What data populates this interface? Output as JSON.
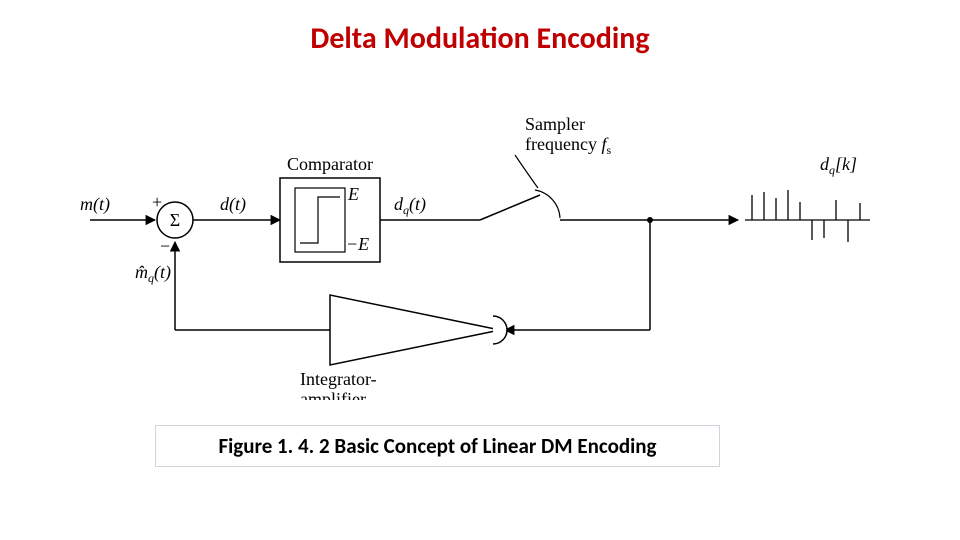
{
  "title": "Delta Modulation Encoding",
  "caption": "Figure 1. 4. 2  Basic Concept of Linear DM Encoding",
  "labels": {
    "input": "m(t)",
    "sum": "Σ",
    "plus": "+",
    "minus": "−",
    "feedback": "m̂",
    "feedback_sub": "q",
    "feedback_arg": "(t)",
    "diff": "d(t)",
    "comparator_title": "Comparator",
    "comp_high": "E",
    "comp_low": "−E",
    "dq": "d",
    "dq_sub": "q",
    "dq_arg": "(t)",
    "sampler_line1": "Sampler",
    "sampler_line2_a": "frequency ",
    "sampler_line2_b": "f",
    "sampler_line2_c": "s",
    "output": "d",
    "output_sub": "q",
    "output_arg": "[k]",
    "amp_line1": "Integrator-",
    "amp_line2": "amplifier"
  }
}
